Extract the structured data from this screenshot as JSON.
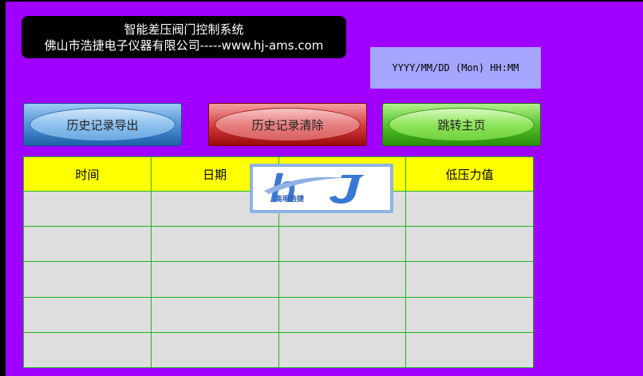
{
  "header": {
    "title_line1": "智能差压阀门控制系统",
    "title_line2": "佛山市浩捷电子仪器有限公司-----www.hj-ams.com"
  },
  "datetime": {
    "format": "YYYY/MM/DD (Mon) HH:MM"
  },
  "buttons": {
    "export_label": "历史记录导出",
    "clear_label": "历史记录清除",
    "main_label": "跳转主页"
  },
  "table": {
    "columns": [
      "时间",
      "日期",
      "",
      "低压力值"
    ],
    "rows": [
      [
        "",
        "",
        "",
        ""
      ],
      [
        "",
        "",
        "",
        ""
      ],
      [
        "",
        "",
        "",
        ""
      ],
      [
        "",
        "",
        "",
        ""
      ],
      [
        "",
        "",
        "",
        ""
      ]
    ]
  },
  "logo": {
    "text": "高明浩捷",
    "icon": "hj-logo-icon"
  },
  "colors": {
    "background": "#a000ff",
    "header_row": "#ffff00",
    "grid_line": "#1fb81f",
    "cell_bg": "#dedede",
    "datetime_bg": "#a6a6ff"
  }
}
